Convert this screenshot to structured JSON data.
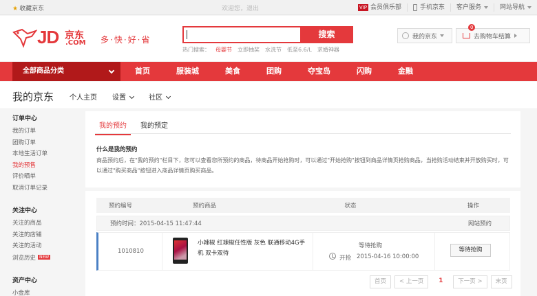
{
  "topbar": {
    "favorite": "收藏京东",
    "login": "欢迎您，退出",
    "vip_tag": "VIP",
    "vip_club": "会员俱乐部",
    "mobile": "手机京东",
    "service": "客户服务",
    "sitemap": "网站导航"
  },
  "header": {
    "logo_jd": "JD",
    "logo_cn": "京东",
    "logo_com": ".COM",
    "slogan": "多·快·好·省",
    "search_button": "搜索",
    "hot_label": "热门搜索：",
    "hot_keywords": [
      "母婴节",
      "立即抽奖",
      "水洗节",
      "低至6.6/L",
      "求婚神器"
    ],
    "my_jd": "我的京东",
    "cart": "去购物车结算",
    "cart_count": "0"
  },
  "mainnav": {
    "all_categories": "全部商品分类",
    "items": [
      "首页",
      "服装城",
      "美食",
      "团购",
      "夺宝岛",
      "闪购",
      "金融"
    ]
  },
  "subhead": {
    "title": "我的京东",
    "nav": [
      "个人主页",
      "设置",
      "社区"
    ]
  },
  "sidebar": {
    "sections": [
      {
        "title": "订单中心",
        "links": [
          "我的订单",
          "团购订单",
          "本地生活订单",
          "我的预售",
          "评价晒单",
          "取消订单记录"
        ]
      },
      {
        "title": "关注中心",
        "links": [
          "关注的商品",
          "关注的店铺",
          "关注的活动",
          "浏览历史"
        ]
      },
      {
        "title": "资产中心",
        "links": [
          "小金库"
        ]
      }
    ],
    "new_badge": "NEW"
  },
  "tabs": [
    "我的预约",
    "我的预定"
  ],
  "faq": {
    "question": "什么是我的预约",
    "answer": "商品预约后，在\"我的预约\"栏目下，您可以查看您所预约的商品，待商品开始抢购时，可以通过\"开始抢购\"按钮到商品详情页抢购商品，当抢购活动结束并开放购买时，可以通过\"购买商品\"按钮进入商品详情页购买商品。"
  },
  "table": {
    "headers": [
      "预约编号",
      "预约商品",
      "状态",
      "操作"
    ],
    "order_time_label": "预约时间：2015-04-15 11:47:44",
    "order_source": "网站预约",
    "row": {
      "order_no": "1010810",
      "product_name": "小辣椒 红辣椒任性版 灰色 联通移动4G手机 双卡双待",
      "status": "等待抢购",
      "start_label": "开抢",
      "start_time": "2015-04-16 10:00:00",
      "action": "等待抢购"
    }
  },
  "pager": {
    "first": "首页",
    "prev": "上一页",
    "current": "1",
    "next": "下一页",
    "last": "末页"
  }
}
